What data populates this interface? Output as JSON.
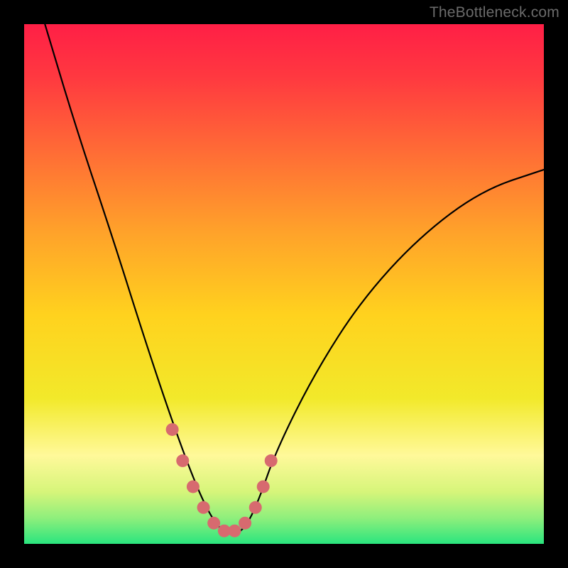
{
  "watermark": "TheBottleneck.com",
  "colors": {
    "background": "#000000",
    "gradient_top": "#ff1f46",
    "gradient_mid": "#ffdb1a",
    "gradient_bottom": "#2ae57e",
    "curve_stroke": "#000000",
    "marker_fill": "#d76a6f"
  },
  "chart_data": {
    "type": "line",
    "title": "",
    "xlabel": "",
    "ylabel": "",
    "xlim": [
      0,
      100
    ],
    "ylim": [
      0,
      100
    ],
    "note": "Axes are hidden; values are approximate percentages of the plot area.",
    "series": [
      {
        "name": "bottleneck-curve",
        "x": [
          4,
          10,
          17,
          23,
          28,
          32,
          35,
          37.5,
          40,
          42.5,
          45,
          48.5,
          56,
          65,
          76,
          88,
          100
        ],
        "y": [
          100,
          80,
          59,
          40,
          25,
          14,
          7,
          3,
          1.5,
          3,
          8,
          18,
          33,
          47,
          59,
          68,
          72
        ]
      }
    ],
    "markers": {
      "name": "highlight-dots",
      "x": [
        28.5,
        30.5,
        32.5,
        34.5,
        36.5,
        38.5,
        40.5,
        42.5,
        44.5,
        46.0,
        47.5
      ],
      "y": [
        22,
        16,
        11,
        7,
        4,
        2.5,
        2.5,
        4,
        7,
        11,
        16
      ]
    }
  }
}
